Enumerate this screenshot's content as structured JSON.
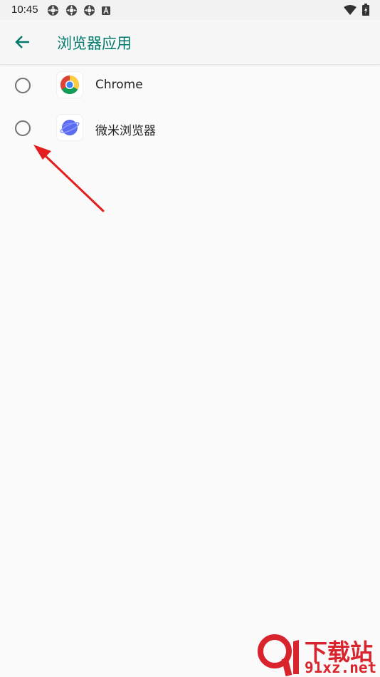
{
  "status_bar": {
    "time": "10:45",
    "notification_icons": [
      "settings-icon",
      "settings-icon",
      "settings-icon",
      "a-badge-icon"
    ],
    "right_icons": [
      "wifi-icon",
      "battery-icon"
    ]
  },
  "app_bar": {
    "title": "浏览器应用",
    "accent_color": "#00796b"
  },
  "browsers": [
    {
      "label": "Chrome",
      "icon": "chrome-icon",
      "selected": false
    },
    {
      "label": "微米浏览器",
      "icon": "planet-icon",
      "selected": false
    }
  ],
  "annotation": {
    "type": "red-arrow",
    "color": "#e31e1e"
  },
  "watermark": {
    "line1": "下载站",
    "line2": "91xz.net"
  }
}
